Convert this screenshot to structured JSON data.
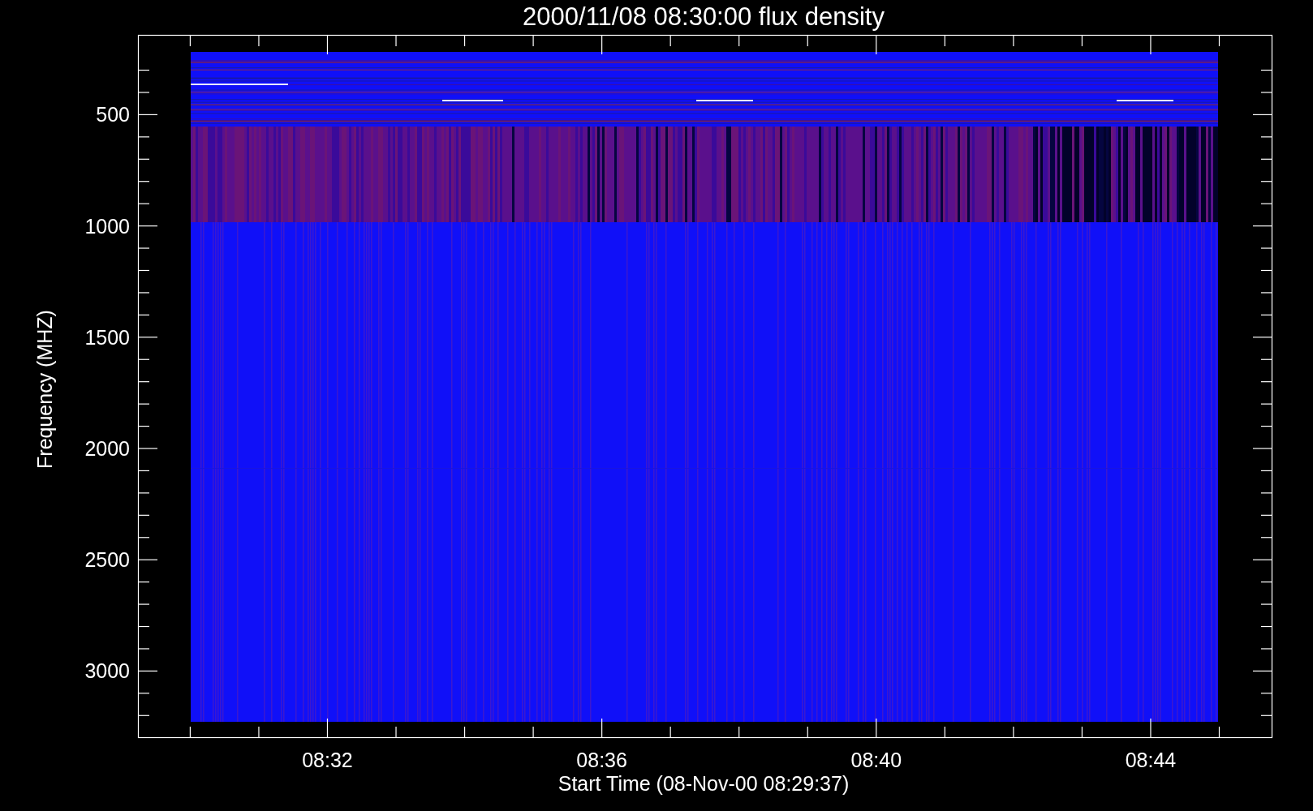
{
  "plot": {
    "title": "2000/11/08 08:30:00 flux density",
    "xlabel": "Start Time (08-Nov-00 08:29:37)",
    "ylabel": "Frequency (MHZ)",
    "xtick_labels": [
      "08:32",
      "08:36",
      "08:40",
      "08:44"
    ],
    "ytick_labels": [
      "500",
      "1000",
      "1500",
      "2000",
      "2500",
      "3000"
    ]
  }
}
